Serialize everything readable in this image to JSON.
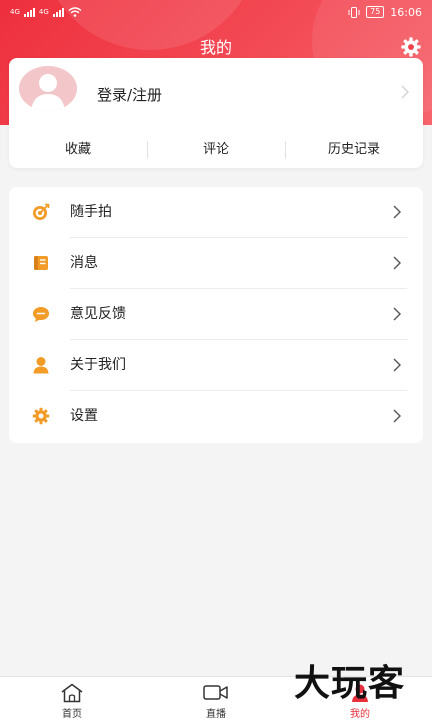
{
  "status_bar": {
    "time": "16:06",
    "battery": "75",
    "network_left": "4G",
    "network_right": "4G"
  },
  "header": {
    "title": "我的",
    "settings_icon": "gear-icon"
  },
  "profile": {
    "login_label": "登录/注册",
    "tabs": [
      {
        "label": "收藏"
      },
      {
        "label": "评论"
      },
      {
        "label": "历史记录"
      }
    ]
  },
  "menu": {
    "items": [
      {
        "label": "随手拍",
        "icon": "target-icon"
      },
      {
        "label": "消息",
        "icon": "message-book-icon"
      },
      {
        "label": "意见反馈",
        "icon": "chat-bubble-icon"
      },
      {
        "label": "关于我们",
        "icon": "person-icon"
      },
      {
        "label": "设置",
        "icon": "gear-icon"
      }
    ]
  },
  "bottom_nav": {
    "items": [
      {
        "label": "首页",
        "icon": "home-icon"
      },
      {
        "label": "直播",
        "icon": "video-camera-icon"
      },
      {
        "label": "我的",
        "icon": "person-icon"
      }
    ],
    "active_index": 2
  },
  "watermark": "大玩客",
  "colors": {
    "accent": "#ee2f3d",
    "icon_orange": "#f29b26",
    "background": "#f4f4f4"
  }
}
